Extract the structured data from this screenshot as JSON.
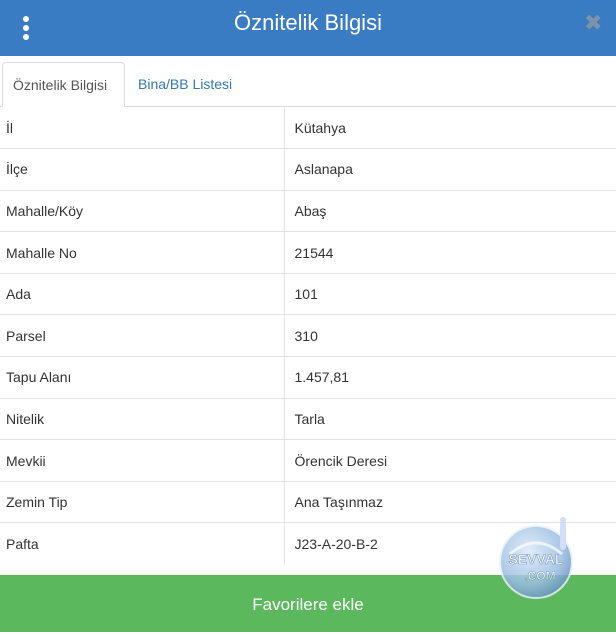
{
  "header": {
    "title": "Öznitelik Bilgisi",
    "close_label": "✖",
    "color": "#3a7cc3"
  },
  "tabs": [
    {
      "label": "Öznitelik Bilgisi",
      "active": true
    },
    {
      "label": "Bina/BB Listesi",
      "active": false
    }
  ],
  "attributes": [
    {
      "key": "İl",
      "value": "Kütahya"
    },
    {
      "key": "İlçe",
      "value": "Aslanapa"
    },
    {
      "key": "Mahalle/Köy",
      "value": "Abaş"
    },
    {
      "key": "Mahalle No",
      "value": "21544"
    },
    {
      "key": "Ada",
      "value": "101"
    },
    {
      "key": "Parsel",
      "value": "310"
    },
    {
      "key": "Tapu Alanı",
      "value": "1.457,81"
    },
    {
      "key": "Nitelik",
      "value": "Tarla"
    },
    {
      "key": "Mevkii",
      "value": "Örencik Deresi"
    },
    {
      "key": "Zemin Tip",
      "value": "Ana Taşınmaz"
    },
    {
      "key": "Pafta",
      "value": "J23-A-20-B-2"
    }
  ],
  "footer": {
    "button_label": "Favorilere ekle",
    "color": "#5cb85c"
  },
  "watermark": {
    "text_top": "SEVVAL",
    "text_bottom": ".COM"
  }
}
